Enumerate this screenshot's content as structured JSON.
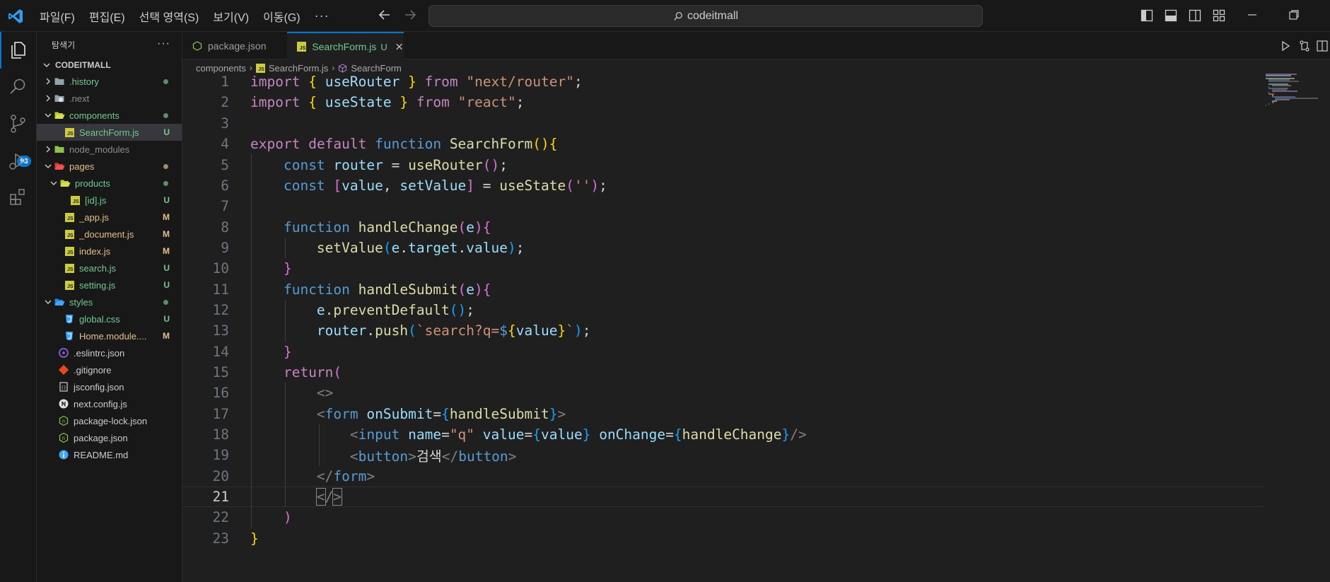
{
  "titlebar": {
    "menu": [
      "파일(F)",
      "편집(E)",
      "선택 영역(S)",
      "보기(V)",
      "이동(G)"
    ],
    "more": "···",
    "search_text": "codeitmall"
  },
  "activity": {
    "source_control_badge": "93"
  },
  "sidebar": {
    "title": "탐색기",
    "more": "···",
    "root": "CODEITMALL",
    "items": [
      {
        "label": ".history",
        "indent": 0,
        "kind": "folder",
        "status": "dot",
        "color": "c-green"
      },
      {
        "label": ".next",
        "indent": 0,
        "kind": "folder-next",
        "status": "",
        "color": "c-gray"
      },
      {
        "label": "components",
        "indent": 0,
        "kind": "folder-open",
        "status": "dot",
        "color": "c-green",
        "open": true
      },
      {
        "label": "SearchForm.js",
        "indent": 1,
        "kind": "js",
        "status": "U",
        "color": "c-green",
        "selected": true
      },
      {
        "label": "node_modules",
        "indent": 0,
        "kind": "folder-node",
        "status": "",
        "color": "c-gray"
      },
      {
        "label": "pages",
        "indent": 0,
        "kind": "folder-pages",
        "status": "dot",
        "color": "c-yellow",
        "open": true
      },
      {
        "label": "products",
        "indent": 1,
        "kind": "folder-open",
        "status": "dot",
        "color": "c-green",
        "open": true
      },
      {
        "label": "[id].js",
        "indent": 2,
        "kind": "js",
        "status": "U",
        "color": "c-green"
      },
      {
        "label": "_app.js",
        "indent": 1,
        "kind": "js",
        "status": "M",
        "color": "c-yellow"
      },
      {
        "label": "_document.js",
        "indent": 1,
        "kind": "js",
        "status": "M",
        "color": "c-yellow"
      },
      {
        "label": "index.js",
        "indent": 1,
        "kind": "js",
        "status": "M",
        "color": "c-yellow"
      },
      {
        "label": "search.js",
        "indent": 1,
        "kind": "js",
        "status": "U",
        "color": "c-green"
      },
      {
        "label": "setting.js",
        "indent": 1,
        "kind": "js",
        "status": "U",
        "color": "c-green"
      },
      {
        "label": "styles",
        "indent": 0,
        "kind": "folder-styles",
        "status": "dot",
        "color": "c-green",
        "open": true
      },
      {
        "label": "global.css",
        "indent": 1,
        "kind": "css",
        "status": "U",
        "color": "c-green"
      },
      {
        "label": "Home.module....",
        "indent": 1,
        "kind": "css",
        "status": "M",
        "color": "c-yellow"
      },
      {
        "label": ".eslintrc.json",
        "indent": 0,
        "kind": "eslint",
        "status": "",
        "color": "c-white",
        "nochev": true
      },
      {
        "label": ".gitignore",
        "indent": 0,
        "kind": "git",
        "status": "",
        "color": "c-white",
        "nochev": true
      },
      {
        "label": "jsconfig.json",
        "indent": 0,
        "kind": "json",
        "status": "",
        "color": "c-white",
        "nochev": true
      },
      {
        "label": "next.config.js",
        "indent": 0,
        "kind": "nextcfg",
        "status": "",
        "color": "c-white",
        "nochev": true
      },
      {
        "label": "package-lock.json",
        "indent": 0,
        "kind": "node",
        "status": "",
        "color": "c-white",
        "nochev": true
      },
      {
        "label": "package.json",
        "indent": 0,
        "kind": "node",
        "status": "",
        "color": "c-white",
        "nochev": true
      },
      {
        "label": "README.md",
        "indent": 0,
        "kind": "info",
        "status": "",
        "color": "c-white",
        "nochev": true
      }
    ]
  },
  "tabs": [
    {
      "label": "package.json",
      "modified": ""
    },
    {
      "label": "SearchForm.js",
      "modified": "U"
    }
  ],
  "breadcrumb": [
    "components",
    "SearchForm.js",
    "SearchForm"
  ],
  "editor": {
    "active_line": 21,
    "lines": [
      {
        "n": "1",
        "html": "<span class='k'>import</span> <span class='br1'>{</span> <span class='v'>useRouter</span> <span class='br1'>}</span> <span class='k'>from</span> <span class='s'>\"next/router\"</span>;"
      },
      {
        "n": "2",
        "html": "<span class='k'>import</span> <span class='br1'>{</span> <span class='v'>useState</span> <span class='br1'>}</span> <span class='k'>from</span> <span class='s'>\"react\"</span>;"
      },
      {
        "n": "3",
        "html": ""
      },
      {
        "n": "4",
        "html": "<span class='k'>export</span> <span class='k'>default</span> <span class='b'>function</span> <span class='f'>SearchForm</span><span class='br1'>()</span><span class='br1'>{</span>"
      },
      {
        "n": "5",
        "html": "    <span class='b'>const</span> <span class='v'>router</span> = <span class='f'>useRouter</span><span class='br2'>()</span>;"
      },
      {
        "n": "6",
        "html": "    <span class='b'>const</span> <span class='br2'>[</span><span class='v'>value</span>, <span class='v'>setValue</span><span class='br2'>]</span> = <span class='f'>useState</span><span class='br2'>(</span><span class='s'>''</span><span class='br2'>)</span>;"
      },
      {
        "n": "7",
        "html": ""
      },
      {
        "n": "8",
        "html": "    <span class='b'>function</span> <span class='f'>handleChange</span><span class='br2'>(</span><span class='v'>e</span><span class='br2'>)</span><span class='br2'>{</span>"
      },
      {
        "n": "9",
        "html": "        <span class='f'>setValue</span><span class='br3'>(</span><span class='v'>e</span>.<span class='v'>target</span>.<span class='v'>value</span><span class='br3'>)</span>;"
      },
      {
        "n": "10",
        "html": "    <span class='br2'>}</span>"
      },
      {
        "n": "11",
        "html": "    <span class='b'>function</span> <span class='f'>handleSubmit</span><span class='br2'>(</span><span class='v'>e</span><span class='br2'>)</span><span class='br2'>{</span>"
      },
      {
        "n": "12",
        "html": "        <span class='v'>e</span>.<span class='f'>preventDefault</span><span class='br3'>()</span>;"
      },
      {
        "n": "13",
        "html": "        <span class='v'>router</span>.<span class='f'>push</span><span class='br3'>(</span><span class='s'>`search?q=</span><span class='b'>$</span><span class='br1'>{</span><span class='v'>value</span><span class='br1'>}</span><span class='s'>`</span><span class='br3'>)</span>;"
      },
      {
        "n": "14",
        "html": "    <span class='br2'>}</span>"
      },
      {
        "n": "15",
        "html": "    <span class='k'>return</span><span class='br2'>(</span>"
      },
      {
        "n": "16",
        "html": "        <span class='tg'>&lt;&gt;</span>"
      },
      {
        "n": "17",
        "html": "        <span class='tg'>&lt;</span><span class='tn'>form</span> <span class='at'>onSubmit</span>=<span class='br3'>{</span><span class='f'>handleSubmit</span><span class='br3'>}</span><span class='tg'>&gt;</span>"
      },
      {
        "n": "18",
        "html": "            <span class='tg'>&lt;</span><span class='tn'>input</span> <span class='at'>name</span>=<span class='s'>\"q\"</span> <span class='at'>value</span>=<span class='br3'>{</span><span class='v'>value</span><span class='br3'>}</span> <span class='at'>onChange</span>=<span class='br3'>{</span><span class='f'>handleChange</span><span class='br3'>}</span><span class='tg'>/&gt;</span>"
      },
      {
        "n": "19",
        "html": "            <span class='tg'>&lt;</span><span class='tn'>button</span><span class='tg'>&gt;</span>검색<span class='tg'>&lt;/</span><span class='tn'>button</span><span class='tg'>&gt;</span>"
      },
      {
        "n": "20",
        "html": "        <span class='tg'>&lt;/</span><span class='tn'>form</span><span class='tg'>&gt;</span>"
      },
      {
        "n": "21",
        "html": "        <span class='tg cursor-box'>&lt;</span><span class='tg'>/</span><span class='tg cursor-box'>&gt;</span>"
      },
      {
        "n": "22",
        "html": "    <span class='br2'>)</span>"
      },
      {
        "n": "23",
        "html": "<span class='br1'>}</span>"
      }
    ]
  },
  "colors": {
    "accent": "#0078d4",
    "untracked": "#73c991",
    "modified": "#e2c08d"
  }
}
